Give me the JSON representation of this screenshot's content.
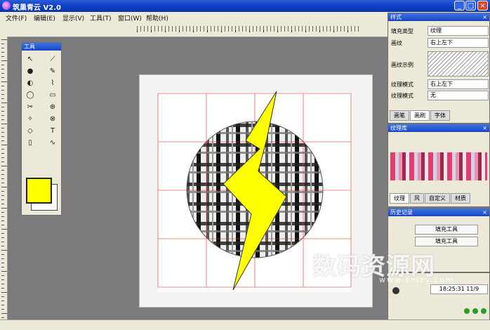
{
  "window": {
    "title": "筑巢青云 V2.0",
    "minimize": "_",
    "maximize": "□",
    "close": "×"
  },
  "menu": [
    "文件(F)",
    "编辑(E)",
    "显示(V)",
    "工具(T)",
    "窗口(W)",
    "帮助(H)"
  ],
  "toolbox": {
    "title": "工具",
    "tools": [
      "↖",
      "⟋",
      "●",
      "✎",
      "◐",
      "⌇",
      "◯",
      "▭",
      "✂",
      "⊕",
      "✧",
      "⊗",
      "◇",
      "T",
      "▯",
      "∿"
    ]
  },
  "colors": {
    "foreground": "#ffff00",
    "background": "#ffffff",
    "accent": "#1846bf"
  },
  "props_panel": {
    "title": "样式",
    "rows": [
      {
        "label": "填充类型",
        "value": "纹理"
      },
      {
        "label": "画纹",
        "value": "右上左下"
      },
      {
        "label": "画纹示例",
        "value": ""
      },
      {
        "label": "纹理模式",
        "value": "右上左下"
      },
      {
        "label": "纹理模式",
        "value": "无"
      }
    ],
    "tabs": [
      "画笔",
      "画刷",
      "字体"
    ]
  },
  "texture_panel": {
    "title": "纹理库",
    "tabs": [
      "纹理",
      "风",
      "自定义",
      "材质"
    ]
  },
  "history_panel": {
    "title": "历史记录",
    "items": [
      "填充工具",
      "填充工具"
    ]
  },
  "info_panel": {
    "time": "18:25:31 11/9"
  },
  "watermark": {
    "main": "数码资源网",
    "sub": "www.smzy.com"
  }
}
